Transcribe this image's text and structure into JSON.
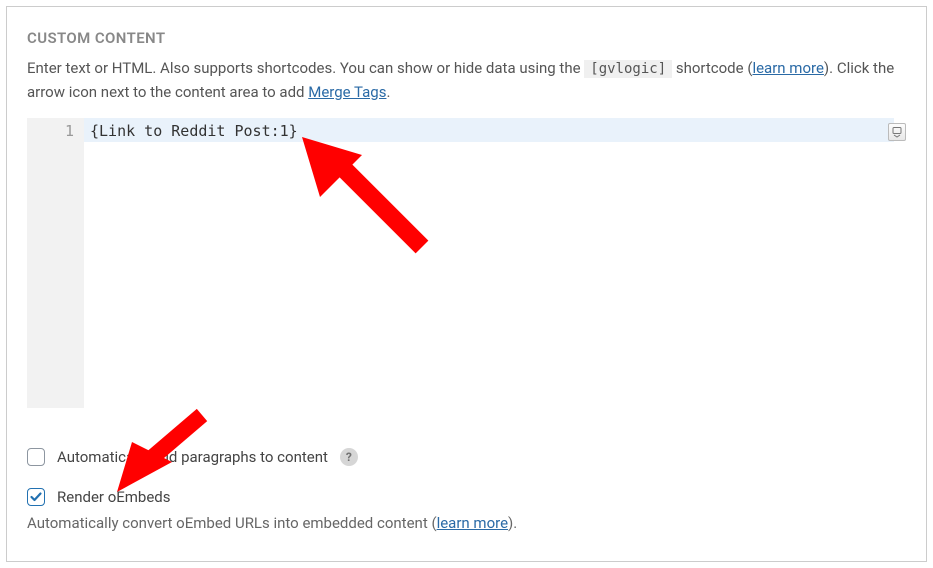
{
  "section": {
    "title": "Custom Content"
  },
  "description": {
    "line1_prefix": "Enter text or HTML. Also supports shortcodes. You can show or hide data using the ",
    "shortcode": "[gvlogic]",
    "line1_suffix": " shortcode (",
    "learn_more": "learn more",
    "line2_prefix": "). Click the arrow icon next to the content area to add ",
    "merge_tags": "Merge Tags",
    "line2_suffix": "."
  },
  "editor": {
    "line_number": "1",
    "content": "{Link to Reddit Post:1}"
  },
  "options": {
    "auto_para": {
      "label": "Automatically add paragraphs to content",
      "checked": false
    },
    "render_oembed": {
      "label": "Render oEmbeds",
      "checked": true
    },
    "oembed_help_prefix": "Automatically convert oEmbed URLs into embedded content (",
    "oembed_help_link": "learn more",
    "oembed_help_suffix": ")."
  }
}
